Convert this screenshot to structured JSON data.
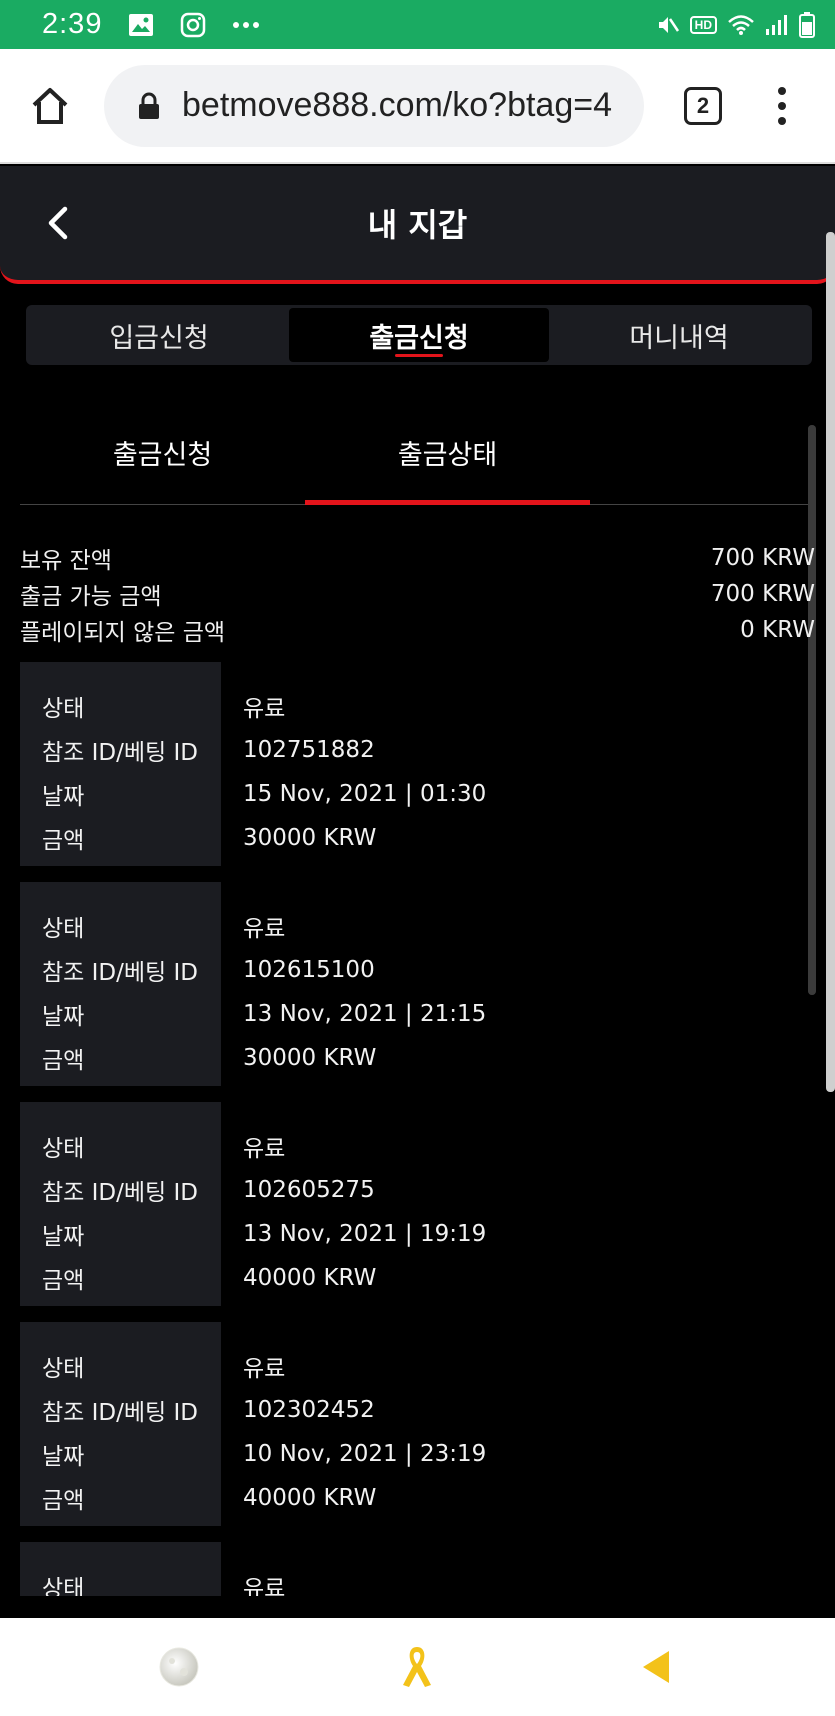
{
  "status_bar": {
    "time": "2:39",
    "icons": [
      "gallery-icon",
      "instagram-icon",
      "more-dots-icon",
      "mute-icon",
      "hd-icon",
      "wifi-icon",
      "signal-icon",
      "battery-icon"
    ],
    "hd_label": "HD"
  },
  "browser": {
    "url": "betmove888.com/ko?btag=4",
    "tab_count": "2"
  },
  "header": {
    "title": "내 지갑"
  },
  "top_tabs": [
    {
      "label": "입금신청",
      "active": false
    },
    {
      "label": "출금신청",
      "active": true
    },
    {
      "label": "머니내역",
      "active": false
    }
  ],
  "sub_tabs": [
    {
      "label": "출금신청",
      "active": false
    },
    {
      "label": "출금상태",
      "active": true
    }
  ],
  "balances": [
    {
      "label": "보유 잔액",
      "value": "700 KRW"
    },
    {
      "label": "출금 가능 금액",
      "value": "700 KRW"
    },
    {
      "label": "플레이되지 않은 금액",
      "value": "0 KRW"
    }
  ],
  "record_labels": {
    "status": "상태",
    "ref_id": "참조 ID/베팅 ID",
    "date": "날짜",
    "amount": "금액"
  },
  "records": [
    {
      "status": "유료",
      "ref_id": "102751882",
      "date": "15 Nov, 2021 | 01:30",
      "amount": "30000 KRW"
    },
    {
      "status": "유료",
      "ref_id": "102615100",
      "date": "13 Nov, 2021 | 21:15",
      "amount": "30000 KRW"
    },
    {
      "status": "유료",
      "ref_id": "102605275",
      "date": "13 Nov, 2021 | 19:19",
      "amount": "40000 KRW"
    },
    {
      "status": "유료",
      "ref_id": "102302452",
      "date": "10 Nov, 2021 | 23:19",
      "amount": "40000 KRW"
    },
    {
      "status": "유료",
      "ref_id": "",
      "date": "",
      "amount": ""
    }
  ],
  "bottom_nav": [
    "moon-icon",
    "ribbon-icon",
    "back-triangle-icon"
  ],
  "colors": {
    "status_bar": "#1aab62",
    "accent": "#e3141b",
    "panel": "#1b1c21",
    "ribbon": "#f3c21a",
    "back_triangle": "#f3c21a"
  }
}
